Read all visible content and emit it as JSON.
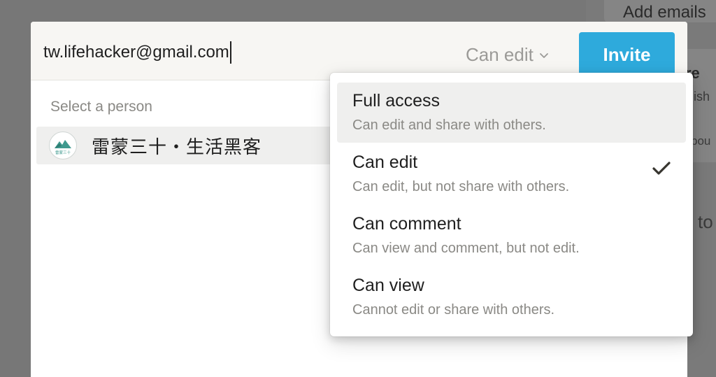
{
  "background": {
    "add_emails": "Add emails",
    "fragment_1": "re",
    "fragment_2": "lish",
    "fragment_3": "bou",
    "fragment_4": "to"
  },
  "invite": {
    "email_value": "tw.lifehacker@gmail.com",
    "permission_selected": "Can edit",
    "button_label": "Invite",
    "button_color": "#2eaadc"
  },
  "people": {
    "section_label": "Select a person",
    "items": [
      {
        "name": "雷蒙三十・生活黑客",
        "avatar_icon": "mountain-logo-icon",
        "avatar_text": "雷蒙三十"
      }
    ]
  },
  "permissions_menu": {
    "items": [
      {
        "title": "Full access",
        "description": "Can edit and share with others.",
        "highlighted": true,
        "selected": false
      },
      {
        "title": "Can edit",
        "description": "Can edit, but not share with others.",
        "highlighted": false,
        "selected": true
      },
      {
        "title": "Can comment",
        "description": "Can view and comment, but not edit.",
        "highlighted": false,
        "selected": false
      },
      {
        "title": "Can view",
        "description": "Cannot edit or share with others.",
        "highlighted": false,
        "selected": false
      }
    ],
    "check_icon": "checkmark-icon"
  }
}
